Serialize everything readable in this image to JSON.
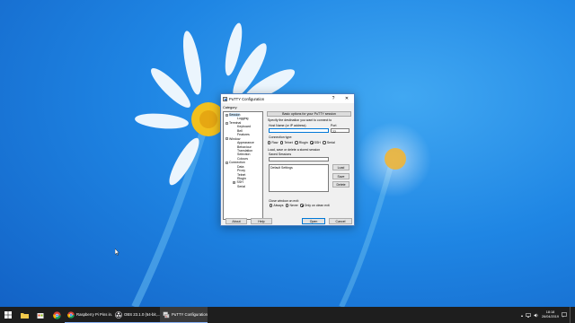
{
  "dialog": {
    "title": "PuTTY Configuration",
    "help_glyph": "?",
    "close_glyph": "✕",
    "category_label": "Category:",
    "tree": [
      {
        "label": "Session",
        "level": 0,
        "expander": "−",
        "selected": true
      },
      {
        "label": "Logging",
        "level": 1
      },
      {
        "label": "Terminal",
        "level": 0,
        "expander": "−"
      },
      {
        "label": "Keyboard",
        "level": 1
      },
      {
        "label": "Bell",
        "level": 1
      },
      {
        "label": "Features",
        "level": 1
      },
      {
        "label": "Window",
        "level": 0,
        "expander": "−"
      },
      {
        "label": "Appearance",
        "level": 1
      },
      {
        "label": "Behaviour",
        "level": 1
      },
      {
        "label": "Translation",
        "level": 1
      },
      {
        "label": "Selection",
        "level": 1
      },
      {
        "label": "Colours",
        "level": 1
      },
      {
        "label": "Connection",
        "level": 0,
        "expander": "−"
      },
      {
        "label": "Data",
        "level": 1
      },
      {
        "label": "Proxy",
        "level": 1
      },
      {
        "label": "Telnet",
        "level": 1
      },
      {
        "label": "Rlogin",
        "level": 1
      },
      {
        "label": "SSH",
        "level": 1,
        "expander": "+"
      },
      {
        "label": "Serial",
        "level": 1
      }
    ],
    "panel_header": "Basic options for your PuTTY session",
    "destination_label": "Specify the destination you want to connect to",
    "host_label": "Host Name (or IP address)",
    "host_value": "",
    "port_label": "Port",
    "port_value": "22",
    "conn_type_label": "Connection type:",
    "conn_types": [
      {
        "label": "Raw",
        "checked": false
      },
      {
        "label": "Telnet",
        "checked": false
      },
      {
        "label": "Rlogin",
        "checked": false
      },
      {
        "label": "SSH",
        "checked": true
      },
      {
        "label": "Serial",
        "checked": false
      }
    ],
    "sessions_label": "Load, save or delete a stored session",
    "saved_sessions_label": "Saved Sessions",
    "saved_sessions_value": "",
    "sessions_list": [
      "Default Settings"
    ],
    "load_btn": "Load",
    "save_btn": "Save",
    "delete_btn": "Delete",
    "close_exit_label": "Close window on exit:",
    "close_exit_options": [
      {
        "label": "Always",
        "checked": false
      },
      {
        "label": "Never",
        "checked": false
      },
      {
        "label": "Only on clean exit",
        "checked": true
      }
    ],
    "about_btn": "About",
    "help_btn": "Help",
    "open_btn": "Open",
    "cancel_btn": "Cancel"
  },
  "taskbar": {
    "tasks": [
      {
        "label": "Raspberry Pi Pins in...",
        "icon": "chrome-icon",
        "active": false
      },
      {
        "label": "OBS 23.1.0 (64-bit,...",
        "icon": "obs-icon",
        "active": false
      },
      {
        "label": "PuTTY Configuration",
        "icon": "putty-icon",
        "active": true
      }
    ],
    "clock_time": "18:18",
    "clock_date": "26/04/2019",
    "colors": {
      "background": "#1e1e1e",
      "accent": "#8ab4f8"
    }
  }
}
